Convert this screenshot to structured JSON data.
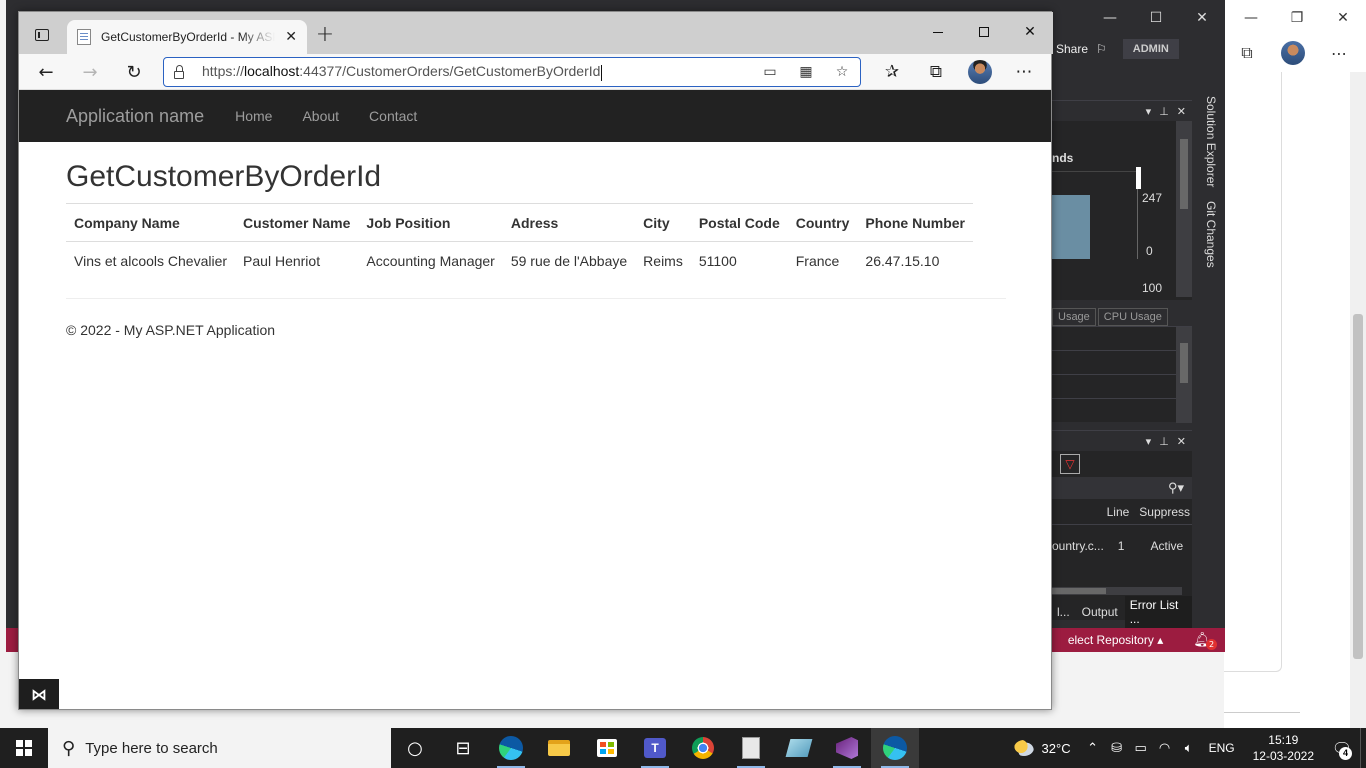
{
  "browser": {
    "tab_title": "GetCustomerByOrderId - My ASP.NET Application",
    "tab_close": "✕",
    "new_tab": "+",
    "url_prefix": "https://",
    "url_host": "localhost",
    "url_rest": ":44377/CustomerOrders/GetCustomerByOrderId",
    "window": {
      "minimize": "",
      "maximize": "",
      "close": "✕"
    }
  },
  "site": {
    "brand": "Application name",
    "nav": [
      "Home",
      "About",
      "Contact"
    ],
    "heading": "GetCustomerByOrderId",
    "table": {
      "columns": [
        "Company Name",
        "Customer Name",
        "Job Position",
        "Adress",
        "City",
        "Postal Code",
        "Country",
        "Phone Number"
      ],
      "rows": [
        [
          "Vins et alcools Chevalier",
          "Paul Henriot",
          "Accounting Manager",
          "59 rue de l'Abbaye",
          "Reims",
          "51100",
          "France",
          "26.47.15.10"
        ]
      ]
    },
    "footer": "© 2022 - My ASP.NET Application"
  },
  "vs": {
    "share": "Share",
    "admin": "ADMIN",
    "diag_label": "nds",
    "diag_max": "247",
    "diag_min": "0",
    "diag_pct": "100",
    "diag_tabs": [
      "Usage",
      "CPU Usage"
    ],
    "error_cols": [
      "Line",
      "Suppress"
    ],
    "error_row": [
      "ountry.c...",
      "1",
      "Active"
    ],
    "bottom_tabs": [
      "l...",
      "Output",
      "Error List ..."
    ],
    "side_tabs": [
      "Solution Explorer",
      "Git Changes"
    ],
    "status_repo": "elect Repository",
    "status_notifications": "2"
  },
  "taskbar": {
    "search_placeholder": "Type here to search",
    "temperature": "32°C",
    "language": "ENG",
    "time": "15:19",
    "date": "12-03-2022",
    "notification_count": "4"
  }
}
